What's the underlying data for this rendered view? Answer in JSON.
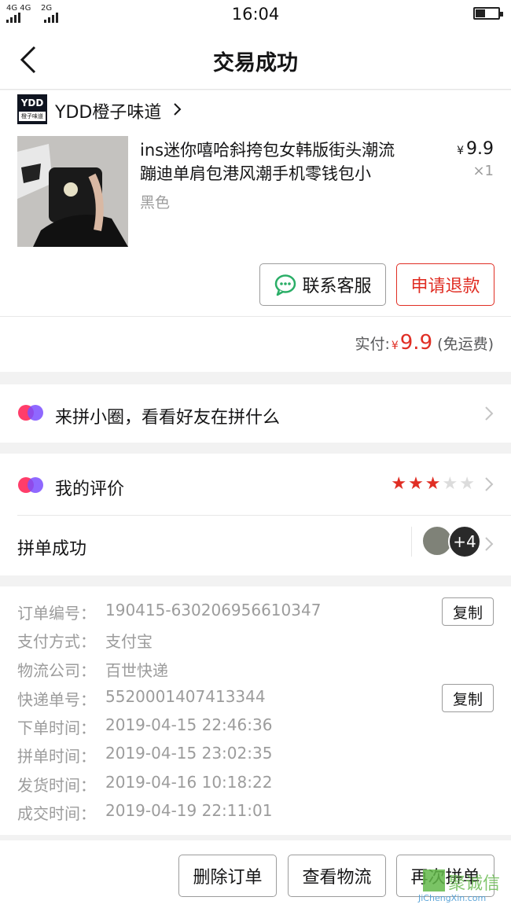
{
  "status_bar": {
    "network_1": "4G 4G",
    "network_2": "2G",
    "time": "16:04"
  },
  "nav": {
    "title": "交易成功",
    "back_icon": "chevron-left-icon"
  },
  "shop": {
    "logo_text": "YDD",
    "logo_subtext": "橙子味道",
    "name": "YDD橙子味道"
  },
  "product": {
    "title_line1": "ins迷你嘻哈斜挎包女韩版街头潮流",
    "title_line2": "蹦迪单肩包港风潮手机零钱包小",
    "spec": "黑色",
    "currency": "¥",
    "price": "9.9",
    "quantity": "×1"
  },
  "actions": {
    "contact_service": "联系客服",
    "request_refund": "申请退款"
  },
  "payment": {
    "label": "实付:",
    "currency": "¥",
    "amount": "9.9",
    "shipping_note": "(免运费)"
  },
  "circle_row": {
    "text": "来拼小圈，看看好友在拼什么"
  },
  "review_row": {
    "text": "我的评价",
    "rating": 3,
    "max_rating": 5
  },
  "group_row": {
    "text": "拼单成功",
    "extra_count": "+4"
  },
  "order_info": {
    "copy_label": "复制",
    "rows": [
      {
        "label": "订单编号：",
        "value": "190415-630206956610347"
      },
      {
        "label": "支付方式：",
        "value": "支付宝"
      },
      {
        "label": "物流公司：",
        "value": "百世快递"
      },
      {
        "label": "快递单号：",
        "value": "5520001407413344"
      },
      {
        "label": "下单时间：",
        "value": "2019-04-15 22:46:36"
      },
      {
        "label": "拼单时间：",
        "value": "2019-04-15 23:02:35"
      },
      {
        "label": "发货时间：",
        "value": "2019-04-16 10:18:22"
      },
      {
        "label": "成交时间：",
        "value": "2019-04-19 22:11:01"
      }
    ]
  },
  "bottom_bar": {
    "delete_order": "删除订单",
    "view_logistics": "查看物流",
    "regroup": "再次拼单"
  },
  "watermark": {
    "text": "聚诚信",
    "url": "JiChengXin.com"
  },
  "colors": {
    "accent_red": "#e02e24",
    "wechat_green": "#2aae67",
    "muted_text": "#9c9c9c"
  }
}
